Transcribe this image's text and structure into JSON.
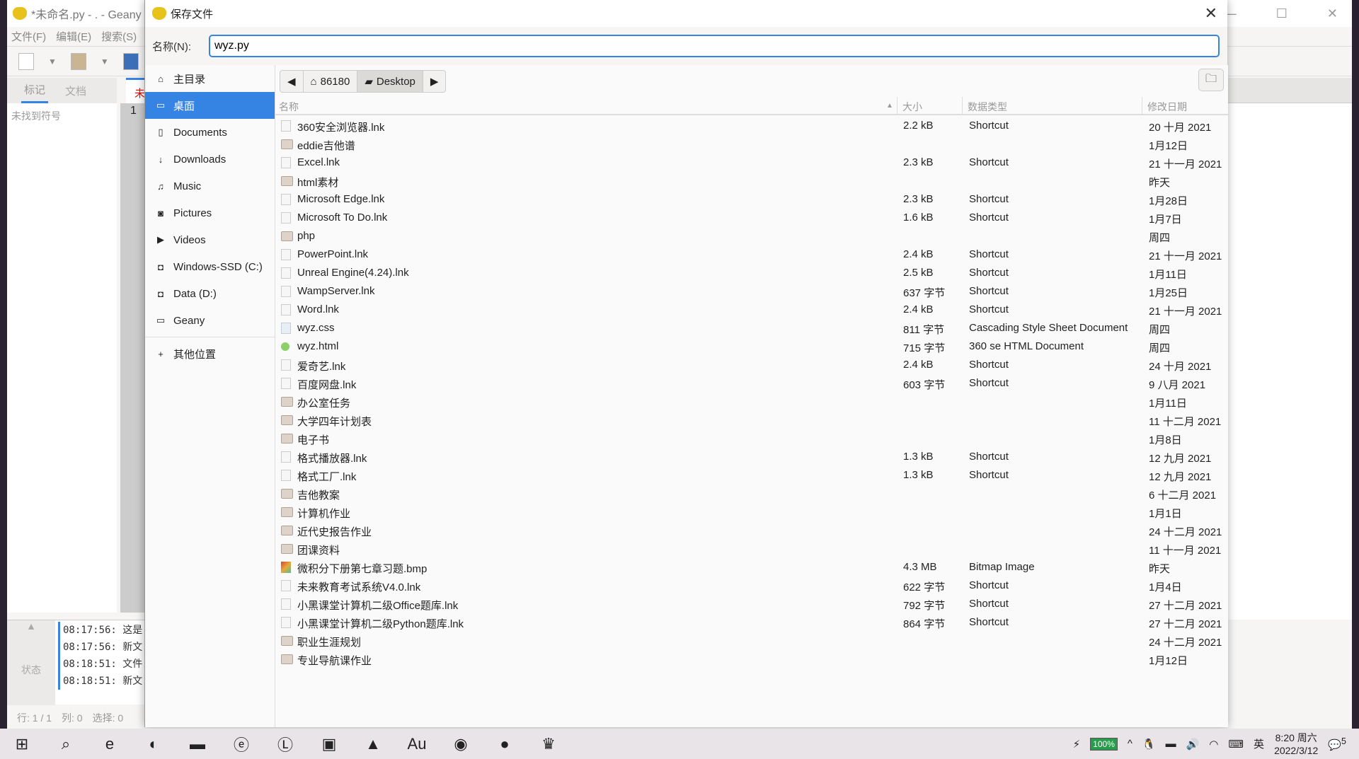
{
  "geany": {
    "title": "*未命名.py - . - Geany (",
    "menu": [
      "文件(F)",
      "编辑(E)",
      "搜索(S)"
    ],
    "side_tabs": [
      "标记",
      "文档"
    ],
    "no_symbols": "未找到符号",
    "editor_tab": "未",
    "line_number": "1",
    "msg_side": "状态",
    "log": [
      "08:17:56: 这是",
      "08:17:56: 新文",
      "08:18:51: 文件",
      "08:18:51: 新文"
    ],
    "status": {
      "line": "行: 1 / 1",
      "col": "列: 0",
      "sel": "选择: 0"
    }
  },
  "dialog": {
    "title": "保存文件",
    "name_label": "名称(N):",
    "name_value": "wyz.py",
    "sidebar": [
      {
        "label": "主目录",
        "icon": "home-icon"
      },
      {
        "label": "桌面",
        "icon": "folder-icon",
        "selected": true
      },
      {
        "label": "Documents",
        "icon": "document-icon"
      },
      {
        "label": "Downloads",
        "icon": "download-icon"
      },
      {
        "label": "Music",
        "icon": "music-icon"
      },
      {
        "label": "Pictures",
        "icon": "camera-icon"
      },
      {
        "label": "Videos",
        "icon": "video-icon"
      },
      {
        "label": "Windows-SSD (C:)",
        "icon": "drive-icon"
      },
      {
        "label": "Data (D:)",
        "icon": "drive-icon"
      },
      {
        "label": "Geany",
        "icon": "folder-icon"
      }
    ],
    "other_locations": "其他位置",
    "path": [
      "86180",
      "Desktop"
    ],
    "columns": {
      "name": "名称",
      "size": "大小",
      "type": "数据类型",
      "modified": "修改日期"
    },
    "files": [
      {
        "name": "360安全浏览器.lnk",
        "kind": "file",
        "size": "2.2 kB",
        "type": "Shortcut",
        "modified": "20 十月 2021"
      },
      {
        "name": "eddie吉他谱",
        "kind": "folder",
        "size": "",
        "type": "",
        "modified": "1月12日"
      },
      {
        "name": "Excel.lnk",
        "kind": "file",
        "size": "2.3 kB",
        "type": "Shortcut",
        "modified": "21 十一月 2021"
      },
      {
        "name": "html素材",
        "kind": "folder",
        "size": "",
        "type": "",
        "modified": "昨天"
      },
      {
        "name": "Microsoft Edge.lnk",
        "kind": "file",
        "size": "2.3 kB",
        "type": "Shortcut",
        "modified": "1月28日"
      },
      {
        "name": "Microsoft To Do.lnk",
        "kind": "file",
        "size": "1.6 kB",
        "type": "Shortcut",
        "modified": "1月7日"
      },
      {
        "name": "php",
        "kind": "folder",
        "size": "",
        "type": "",
        "modified": "周四"
      },
      {
        "name": "PowerPoint.lnk",
        "kind": "file",
        "size": "2.4 kB",
        "type": "Shortcut",
        "modified": "21 十一月 2021"
      },
      {
        "name": "Unreal Engine(4.24).lnk",
        "kind": "file",
        "size": "2.5 kB",
        "type": "Shortcut",
        "modified": "1月11日"
      },
      {
        "name": "WampServer.lnk",
        "kind": "file",
        "size": "637 字节",
        "type": "Shortcut",
        "modified": "1月25日"
      },
      {
        "name": "Word.lnk",
        "kind": "file",
        "size": "2.4 kB",
        "type": "Shortcut",
        "modified": "21 十一月 2021"
      },
      {
        "name": "wyz.css",
        "kind": "css",
        "size": "811 字节",
        "type": "Cascading Style Sheet Document",
        "modified": "周四"
      },
      {
        "name": "wyz.html",
        "kind": "html",
        "size": "715 字节",
        "type": "360 se HTML Document",
        "modified": "周四"
      },
      {
        "name": "爱奇艺.lnk",
        "kind": "file",
        "size": "2.4 kB",
        "type": "Shortcut",
        "modified": "24 十月 2021"
      },
      {
        "name": "百度网盘.lnk",
        "kind": "file",
        "size": "603 字节",
        "type": "Shortcut",
        "modified": "9 八月 2021"
      },
      {
        "name": "办公室任务",
        "kind": "folder",
        "size": "",
        "type": "",
        "modified": "1月11日"
      },
      {
        "name": "大学四年计划表",
        "kind": "folder",
        "size": "",
        "type": "",
        "modified": "11 十二月 2021"
      },
      {
        "name": "电子书",
        "kind": "folder",
        "size": "",
        "type": "",
        "modified": "1月8日"
      },
      {
        "name": "格式播放器.lnk",
        "kind": "file",
        "size": "1.3 kB",
        "type": "Shortcut",
        "modified": "12 九月 2021"
      },
      {
        "name": "格式工厂.lnk",
        "kind": "file",
        "size": "1.3 kB",
        "type": "Shortcut",
        "modified": "12 九月 2021"
      },
      {
        "name": "吉他教案",
        "kind": "folder",
        "size": "",
        "type": "",
        "modified": "6 十二月 2021"
      },
      {
        "name": "计算机作业",
        "kind": "folder",
        "size": "",
        "type": "",
        "modified": "1月1日"
      },
      {
        "name": "近代史报告作业",
        "kind": "folder",
        "size": "",
        "type": "",
        "modified": "24 十二月 2021"
      },
      {
        "name": "团课资料",
        "kind": "folder",
        "size": "",
        "type": "",
        "modified": "11 十一月 2021"
      },
      {
        "name": "微积分下册第七章习题.bmp",
        "kind": "image",
        "size": "4.3 MB",
        "type": "Bitmap Image",
        "modified": "昨天"
      },
      {
        "name": "未来教育考试系统V4.0.lnk",
        "kind": "file",
        "size": "622 字节",
        "type": "Shortcut",
        "modified": "1月4日"
      },
      {
        "name": "小黑课堂计算机二级Office题库.lnk",
        "kind": "file",
        "size": "792 字节",
        "type": "Shortcut",
        "modified": "27 十二月 2021"
      },
      {
        "name": "小黑课堂计算机二级Python题库.lnk",
        "kind": "file",
        "size": "864 字节",
        "type": "Shortcut",
        "modified": "27 十二月 2021"
      },
      {
        "name": "职业生涯规划",
        "kind": "folder",
        "size": "",
        "type": "",
        "modified": "24 十二月 2021"
      },
      {
        "name": "专业导航课作业",
        "kind": "folder",
        "size": "",
        "type": "",
        "modified": "1月12日"
      }
    ]
  },
  "taskbar": {
    "apps": [
      "start-icon",
      "search-icon",
      "ie-icon",
      "edge-icon",
      "file-explorer-icon",
      "browser-e-icon",
      "lark-icon",
      "wechat-work-icon",
      "photos-icon",
      "audition-icon",
      "firefox-icon",
      "avatar-app-icon",
      "geany-icon"
    ],
    "battery": "100%",
    "ime": "英",
    "time": "8:20 周六",
    "date": "2022/3/12",
    "notifications": "5"
  },
  "colors": {
    "accent": "#3584e4",
    "taskbar": "#e9e4e7"
  }
}
